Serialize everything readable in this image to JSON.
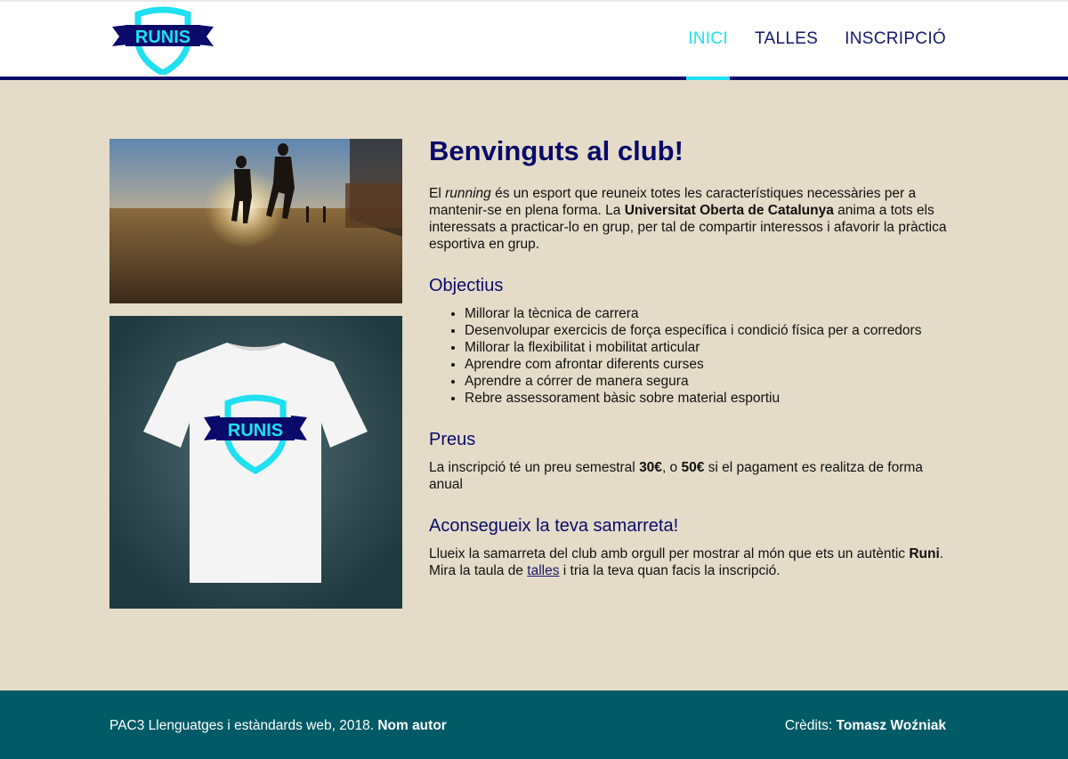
{
  "logo": {
    "text": "RUNIS"
  },
  "nav": {
    "items": [
      {
        "label": "INICI"
      },
      {
        "label": "TALLES"
      },
      {
        "label": "INSCRIPCIÓ"
      }
    ]
  },
  "main": {
    "title": "Benvinguts al club!",
    "intro": {
      "t1": "El ",
      "running": "running",
      "t2": " és un esport que reuneix totes les característiques necessàries per a mantenir-se en plena forma. La ",
      "uoc": "Universitat Oberta de Catalunya",
      "t3": " anima a tots els interessats a practicar-lo en grup, per tal de compartir interessos i afavorir la pràctica esportiva en grup."
    },
    "objectives_title": "Objectius",
    "objectives": [
      "Millorar la tècnica de carrera",
      "Desenvolupar exercicis de força específica i condició física per a corredors",
      "Millorar la flexibilitat i mobilitat articular",
      "Aprendre com afrontar diferents curses",
      "Aprendre a córrer de manera segura",
      "Rebre assessorament bàsic sobre material esportiu"
    ],
    "prices_title": "Preus",
    "prices": {
      "t1": "La inscripció té un preu semestral ",
      "p1": "30€",
      "t2": ", o ",
      "p2": "50€",
      "t3": " si el pagament es realitza de forma anual"
    },
    "shirt_title": "Aconsegueix la teva samarreta!",
    "shirt": {
      "t1": "Llueix la samarreta del club amb orgull per mostrar al món que ets un autèntic ",
      "runi": "Runi",
      "t2": ". Mira la taula de ",
      "link": "talles",
      "t3": " i tria la teva quan facis la inscripció."
    }
  },
  "footer": {
    "left_text": "PAC3 Llenguatges i estàndards web, 2018. ",
    "author": "Nom autor",
    "credits_label": "Crèdits: ",
    "credits_name": "Tomasz Woźniak"
  },
  "colors": {
    "background": "#e4dcc8",
    "navy": "#0a0a6b",
    "accent_cyan": "#1ee0f0",
    "footer": "#005b66"
  }
}
